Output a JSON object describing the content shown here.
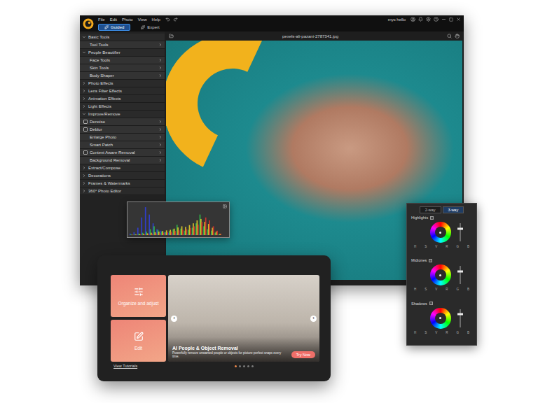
{
  "app": {
    "menu": [
      "File",
      "Edit",
      "Photo",
      "View",
      "Help"
    ],
    "modes": [
      {
        "label": "Guided",
        "selected": true
      },
      {
        "label": "Expert",
        "selected": false
      }
    ],
    "user": "myc hello"
  },
  "canvas": {
    "filename": "pexels-ali-pazani-2787341.jpg"
  },
  "sidebar": {
    "items": [
      {
        "label": "Basic Tools",
        "kind": "section",
        "expanded": true
      },
      {
        "label": "Tool Tools",
        "kind": "tool"
      },
      {
        "label": "People Beautifier",
        "kind": "section",
        "expanded": true
      },
      {
        "label": "Face Tools",
        "kind": "tool"
      },
      {
        "label": "Skin Tools",
        "kind": "tool"
      },
      {
        "label": "Body Shaper",
        "kind": "tool"
      },
      {
        "label": "Photo Effects",
        "kind": "section",
        "expanded": false
      },
      {
        "label": "Lens Filter Effects",
        "kind": "section",
        "expanded": false
      },
      {
        "label": "Animation Effects",
        "kind": "section",
        "expanded": false
      },
      {
        "label": "Light Effects",
        "kind": "section",
        "expanded": false
      },
      {
        "label": "Improve/Remove",
        "kind": "section",
        "expanded": true
      },
      {
        "label": "Denoise",
        "kind": "tool-icon"
      },
      {
        "label": "Deblur",
        "kind": "tool-icon"
      },
      {
        "label": "Enlarge Photo",
        "kind": "tool"
      },
      {
        "label": "Smart Patch",
        "kind": "tool"
      },
      {
        "label": "Content Aware Removal",
        "kind": "tool-icon"
      },
      {
        "label": "Background Removal",
        "kind": "tool"
      },
      {
        "label": "Extract/Compose",
        "kind": "section",
        "expanded": false
      },
      {
        "label": "Decorations",
        "kind": "section",
        "expanded": false
      },
      {
        "label": "Frames & Watermarks",
        "kind": "section",
        "expanded": false
      },
      {
        "label": "360° Photo Editor",
        "kind": "section",
        "expanded": false
      }
    ]
  },
  "histogram": {
    "series": [
      {
        "name": "blue",
        "color": "#2f3fe0",
        "values": [
          5,
          10,
          25,
          60,
          95,
          70,
          40,
          20,
          15,
          10,
          8,
          6,
          5,
          4,
          4,
          3,
          3,
          3,
          2,
          2,
          2,
          1,
          1,
          1
        ]
      },
      {
        "name": "green",
        "color": "#2fc24a",
        "values": [
          2,
          3,
          5,
          8,
          12,
          20,
          30,
          18,
          12,
          10,
          14,
          20,
          35,
          22,
          15,
          18,
          25,
          40,
          70,
          30,
          20,
          15,
          8,
          3
        ]
      },
      {
        "name": "yellow",
        "color": "#e8d22a",
        "values": [
          1,
          2,
          3,
          4,
          6,
          8,
          10,
          12,
          14,
          16,
          18,
          22,
          26,
          30,
          28,
          34,
          40,
          50,
          55,
          45,
          38,
          25,
          12,
          4
        ]
      },
      {
        "name": "red",
        "color": "#e0342c",
        "values": [
          1,
          1,
          2,
          3,
          4,
          5,
          6,
          7,
          8,
          10,
          12,
          14,
          16,
          18,
          20,
          24,
          30,
          36,
          45,
          60,
          50,
          30,
          15,
          5
        ]
      }
    ]
  },
  "color_panel": {
    "tabs": [
      {
        "label": "2-way",
        "selected": false
      },
      {
        "label": "3-way",
        "selected": true
      }
    ],
    "wheels": [
      {
        "label": "Highlights",
        "checked": false,
        "level": 0.7,
        "channels": [
          "H",
          "S",
          "V",
          "R",
          "G",
          "B"
        ]
      },
      {
        "label": "Midtones",
        "checked": false,
        "level": 0.7,
        "channels": [
          "H",
          "S",
          "V",
          "R",
          "G",
          "B"
        ]
      },
      {
        "label": "Shadows",
        "checked": false,
        "level": 0.7,
        "channels": [
          "H",
          "S",
          "V",
          "R",
          "G",
          "B"
        ]
      }
    ]
  },
  "launcher": {
    "cards": [
      {
        "label": "Organize and adjust",
        "kind": "organize"
      },
      {
        "label": "Edit",
        "kind": "edit"
      }
    ],
    "slide": {
      "title": "AI People & Object Removal",
      "description": "Powerfully remove unwanted people or objects for picture-perfect snaps every time.",
      "button": "Try Now"
    },
    "arrows": [
      "‹",
      "›"
    ],
    "dots": [
      {
        "selected": true
      },
      {
        "selected": false
      },
      {
        "selected": false
      },
      {
        "selected": false
      },
      {
        "selected": false
      }
    ],
    "link": "View Tutorials"
  }
}
